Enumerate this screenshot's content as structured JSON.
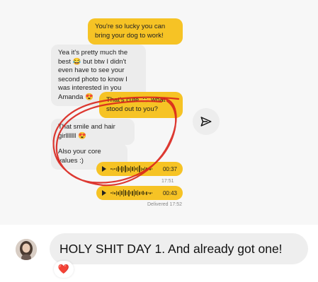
{
  "messages": {
    "m1": "You're so lucky you can bring your dog to work!",
    "m2": "Yea it's pretty much the best 😂 but btw I didn't even have to see your second photo to know I was interested in you Amanda 😍",
    "m3": "That's cute 😊 what stood out to you?",
    "m4": "That smile and hair girlllllll 😍",
    "m5": "Also your core values :)"
  },
  "audio": [
    {
      "duration": "00:37"
    },
    {
      "duration": "00:43"
    }
  ],
  "timestamps": {
    "t1": "17:51",
    "delivered": "Delivered 17:52"
  },
  "send_icon": "paper-plane-icon",
  "comment": {
    "text": "HOLY SHIT DAY 1. And already got one!",
    "reaction": "❤️"
  },
  "colors": {
    "accent": "#f6c325",
    "bubble_gray": "#ececec",
    "annotation": "#d9231c"
  }
}
